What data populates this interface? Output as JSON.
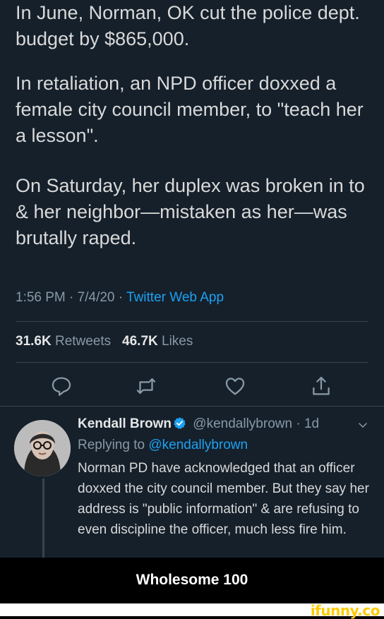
{
  "tweet": {
    "paragraphs": [
      "In June, Norman, OK cut the police dept. budget by $865,000.",
      "In retaliation, an NPD officer doxxed a female city council member, to \"teach her a lesson\".",
      "On Saturday, her duplex was broken in to & her neighbor—mistaken as her—was brutally raped."
    ],
    "time": "1:56 PM",
    "date": "7/4/20",
    "separator": " · ",
    "source": "Twitter Web App",
    "retweets_count": "31.6K",
    "retweets_label": "Retweets",
    "likes_count": "46.7K",
    "likes_label": "Likes"
  },
  "actions": {
    "icons": [
      "reply-icon",
      "retweet-icon",
      "like-icon",
      "share-icon"
    ]
  },
  "reply": {
    "name": "Kendall Brown",
    "handle": "@kendallybrown",
    "age": "1d",
    "replying_label": "Replying to",
    "replying_to": "@kendallybrown",
    "text": "Norman PD have acknowledged that an officer doxxed the city council member. But they say her address is \"public information\" & are refusing to even discipline the officer, much less fire him."
  },
  "caption": "Wholesome 100",
  "watermark": "ifunny.co",
  "colors": {
    "background": "#15202b",
    "accent": "#1da1f2",
    "muted": "#8899a6",
    "watermark": "#ffcc00"
  }
}
